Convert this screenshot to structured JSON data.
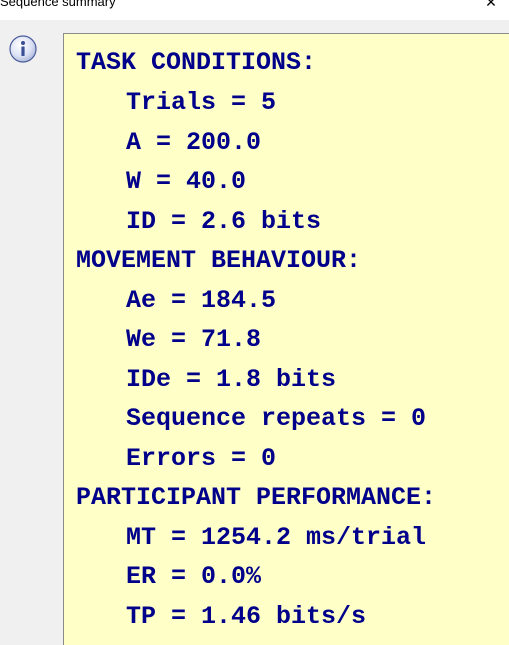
{
  "window": {
    "title": "Sequence summary",
    "close_glyph": "✕"
  },
  "icon": "info-icon",
  "colors": {
    "text": "#00008b",
    "box_background": "#ffffc8",
    "window_background": "#f0f0f0"
  },
  "summary": {
    "task_conditions": {
      "heading": "TASK CONDITIONS:",
      "trials": "Trials = 5",
      "a": "A = 200.0",
      "w": "W = 40.0",
      "id": "ID = 2.6 bits"
    },
    "movement_behaviour": {
      "heading": "MOVEMENT BEHAVIOUR:",
      "ae": "Ae = 184.5",
      "we": "We = 71.8",
      "ide": "IDe = 1.8 bits",
      "sequence_repeats": "Sequence repeats = 0",
      "errors": "Errors = 0"
    },
    "participant_performance": {
      "heading": "PARTICIPANT PERFORMANCE:",
      "mt": "MT = 1254.2 ms/trial",
      "er": "ER = 0.0%",
      "tp": "TP = 1.46 bits/s"
    }
  }
}
